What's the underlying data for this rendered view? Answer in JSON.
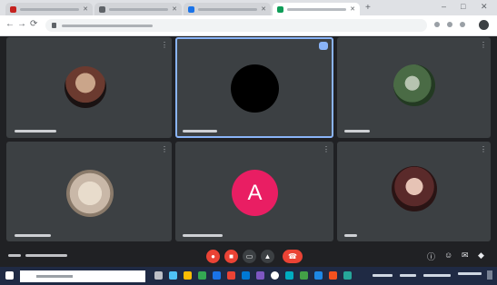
{
  "browser": {
    "tabs": [
      {
        "favicon_color": "#c5221f",
        "active": false
      },
      {
        "favicon_color": "#5f6368",
        "active": false
      },
      {
        "favicon_color": "#1a73e8",
        "active": false
      },
      {
        "favicon_color": "#0f9d58",
        "active": true
      }
    ],
    "new_tab_glyph": "+",
    "window_controls": [
      "–",
      "□",
      "✕"
    ],
    "nav": {
      "back": "←",
      "forward": "→",
      "reload": "⟳"
    }
  },
  "meeting": {
    "participants": [
      {
        "avatar_type": "photo",
        "avatar_color": "#6b3a2f",
        "speaking": false
      },
      {
        "avatar_type": "photo",
        "avatar_color": "#000000",
        "speaking": true
      },
      {
        "avatar_type": "photo",
        "avatar_color": "#4a6b45",
        "speaking": false
      },
      {
        "avatar_type": "photo",
        "avatar_color": "#c9b8a8",
        "speaking": false
      },
      {
        "avatar_type": "initial",
        "initial": "A",
        "avatar_color": "#e91e63",
        "speaking": false
      },
      {
        "avatar_type": "photo",
        "avatar_color": "#5a2a2a",
        "speaking": false
      }
    ],
    "controls": {
      "mic_color": "#ea4335",
      "camera_color": "#ea4335",
      "neutral_color": "#3c4043",
      "end_color": "#ea4335"
    }
  },
  "colors": {
    "accent": "#8ab4f8",
    "tile": "#3c4043",
    "background": "#202124",
    "taskbar": "#1f2a44"
  }
}
